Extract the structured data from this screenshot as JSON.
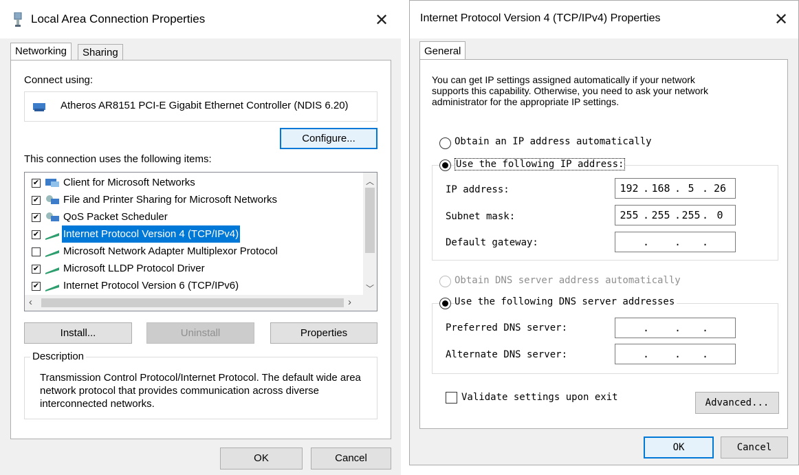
{
  "left": {
    "title": "Local Area Connection Properties",
    "tabs": [
      "Networking",
      "Sharing"
    ],
    "connect_using_label": "Connect using:",
    "adapter_name": "Atheros AR8151 PCI-E Gigabit Ethernet Controller (NDIS 6.20)",
    "configure_label": "Configure...",
    "items_label": "This connection uses the following items:",
    "items": [
      {
        "label": "Client for Microsoft Networks",
        "checked": true
      },
      {
        "label": "File and Printer Sharing for Microsoft Networks",
        "checked": true
      },
      {
        "label": "QoS Packet Scheduler",
        "checked": true
      },
      {
        "label": "Internet Protocol Version 4 (TCP/IPv4)",
        "checked": true,
        "selected": true
      },
      {
        "label": "Microsoft Network Adapter Multiplexor Protocol",
        "checked": false
      },
      {
        "label": "Microsoft LLDP Protocol Driver",
        "checked": true
      },
      {
        "label": "Internet Protocol Version 6 (TCP/IPv6)",
        "checked": true
      }
    ],
    "install_label": "Install...",
    "uninstall_label": "Uninstall",
    "properties_label": "Properties",
    "description_title": "Description",
    "description_text": "Transmission Control Protocol/Internet Protocol. The default wide area network protocol that provides communication across diverse interconnected networks.",
    "ok_label": "OK",
    "cancel_label": "Cancel"
  },
  "right": {
    "title": "Internet Protocol Version 4 (TCP/IPv4) Properties",
    "tab": "General",
    "intro": "You can get IP settings assigned automatically if your network supports this capability. Otherwise, you need to ask your network administrator for the appropriate IP settings.",
    "radio_auto_ip": "Obtain an IP address automatically",
    "radio_manual_ip": "Use the following IP address:",
    "ip_label": "IP address:",
    "ip_value": [
      "192",
      "168",
      "5",
      "26"
    ],
    "subnet_label": "Subnet mask:",
    "subnet_value": [
      "255",
      "255",
      "255",
      "0"
    ],
    "gateway_label": "Default gateway:",
    "radio_auto_dns": "Obtain DNS server address automatically",
    "radio_manual_dns": "Use the following DNS server addresses",
    "preferred_dns_label": "Preferred DNS server:",
    "alternate_dns_label": "Alternate DNS server:",
    "validate_label": "Validate settings upon exit",
    "advanced_label": "Advanced...",
    "ok_label": "OK",
    "cancel_label": "Cancel"
  }
}
